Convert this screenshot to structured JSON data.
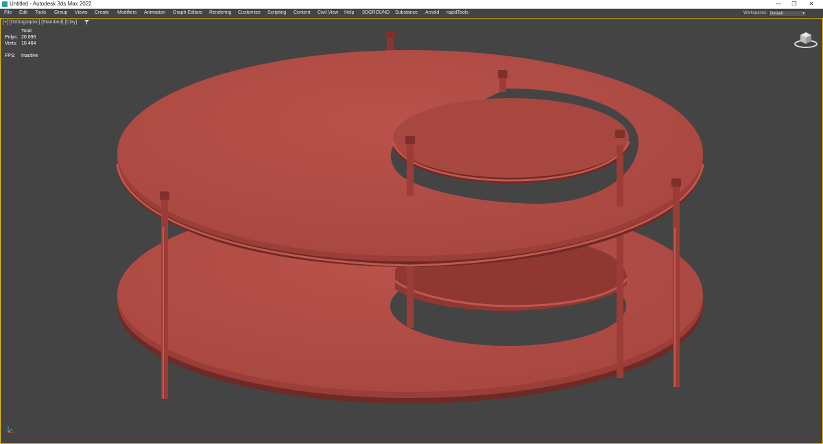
{
  "window": {
    "title": "Untitled - Autodesk 3ds Max 2022",
    "controls": {
      "minimize": "—",
      "restore": "❐",
      "close": "✕"
    }
  },
  "menu": {
    "items": [
      "File",
      "Edit",
      "Tools",
      "Group",
      "Views",
      "Create",
      "Modifiers",
      "Animation",
      "Graph Editors",
      "Rendering",
      "Customize",
      "Scripting",
      "Content",
      "Civil View",
      "Help",
      "3DGROUND",
      "Substance",
      "Arnold",
      "rapidTools"
    ]
  },
  "workspace": {
    "label": "Workspaces:",
    "value": "Default"
  },
  "viewport": {
    "label": "[+] [Orthographic] [Standard] [Clay]",
    "filter_icon": "funnel-icon",
    "stats": {
      "header": "Total",
      "polys_label": "Polys:",
      "polys_value": "20 896",
      "verts_label": "Verts:",
      "verts_value": "10 464",
      "fps_label": "FPS:",
      "fps_value": "Inactive"
    }
  },
  "colors": {
    "clay": "#b04a42",
    "clay_dark": "#7e302b",
    "background": "#444444",
    "viewport_border": "#e8c000"
  }
}
